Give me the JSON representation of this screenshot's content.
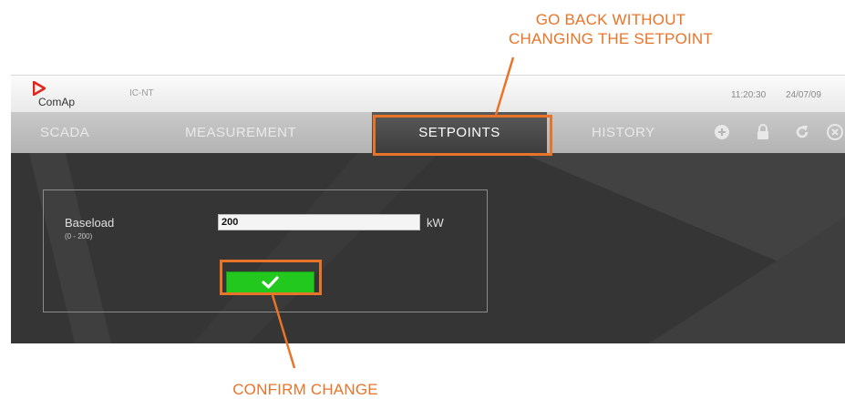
{
  "callouts": {
    "top_line1": "GO BACK WITHOUT",
    "top_line2": "CHANGING THE SETPOINT",
    "bottom": "CONFIRM CHANGE"
  },
  "titlebar": {
    "logo": "ComAp",
    "device": "IC-NT",
    "time": "11:20:30",
    "date": "24/07/09"
  },
  "nav": {
    "tabs": [
      {
        "label": "SCADA"
      },
      {
        "label": "MEASUREMENT"
      },
      {
        "label": "SETPOINTS",
        "active": true
      },
      {
        "label": "HISTORY"
      }
    ],
    "icons": [
      "plus-circle-icon",
      "lock-icon",
      "refresh-icon",
      "close-circle-icon"
    ]
  },
  "setpoint": {
    "name": "Baseload",
    "range": "(0 - 200)",
    "value": "200",
    "unit": "kW"
  },
  "colors": {
    "accent": "#e8742a",
    "confirm": "#23c81e",
    "content_bg": "#353535",
    "logo_red": "#e0271d"
  }
}
